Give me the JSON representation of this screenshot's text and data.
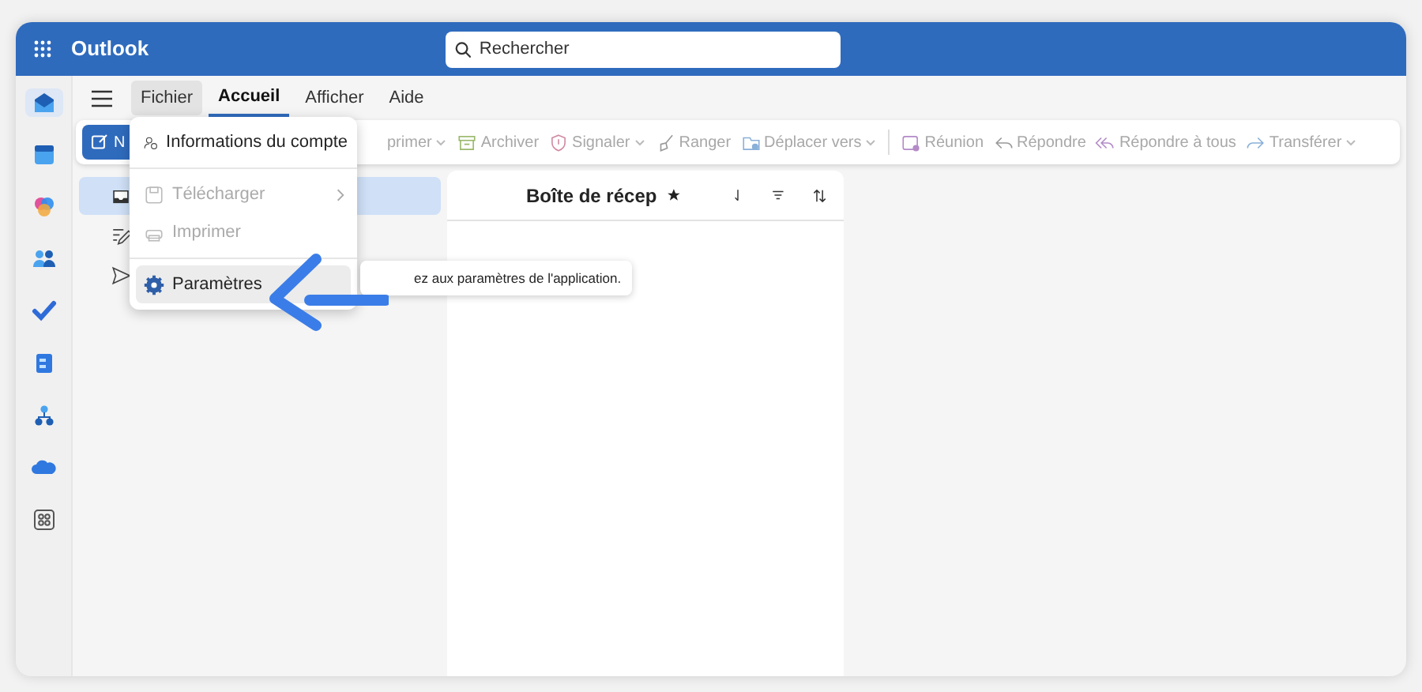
{
  "app": {
    "title": "Outlook",
    "search": {
      "placeholder": "Rechercher"
    }
  },
  "rail": [
    {
      "kind": "mail",
      "selected": true
    },
    {
      "kind": "calendar",
      "selected": false
    },
    {
      "kind": "copilot",
      "selected": false
    },
    {
      "kind": "people",
      "selected": false
    },
    {
      "kind": "todo",
      "selected": false
    },
    {
      "kind": "book",
      "selected": false
    },
    {
      "kind": "org",
      "selected": false
    },
    {
      "kind": "cloud",
      "selected": false
    },
    {
      "kind": "apps",
      "selected": false
    }
  ],
  "tabs": [
    {
      "label": "Fichier",
      "selected": false,
      "open": true
    },
    {
      "label": "Accueil",
      "selected": true,
      "open": false
    },
    {
      "label": "Afficher",
      "selected": false,
      "open": false
    },
    {
      "label": "Aide",
      "selected": false,
      "open": false
    }
  ],
  "toolbar": {
    "new_button": "N",
    "items": [
      {
        "kind": "delete",
        "label": "primer",
        "disabled": true,
        "dropdown": true
      },
      {
        "kind": "archive",
        "label": "Archiver",
        "disabled": true,
        "dropdown": false
      },
      {
        "kind": "report",
        "label": "Signaler",
        "disabled": true,
        "dropdown": true
      },
      {
        "kind": "sweep",
        "label": "Ranger",
        "disabled": true,
        "dropdown": false
      },
      {
        "kind": "move",
        "label": "Déplacer vers",
        "disabled": true,
        "dropdown": true
      },
      {
        "kind": "meeting",
        "label": "Réunion",
        "disabled": true,
        "dropdown": false
      },
      {
        "kind": "reply",
        "label": "Répondre",
        "disabled": true,
        "dropdown": false
      },
      {
        "kind": "replyall",
        "label": "Répondre à tous",
        "disabled": true,
        "dropdown": false
      },
      {
        "kind": "forward",
        "label": "Transférer",
        "disabled": true,
        "dropdown": true
      }
    ]
  },
  "folders": [
    {
      "kind": "inbox",
      "selected": true
    },
    {
      "kind": "drafts",
      "selected": false
    },
    {
      "kind": "sent",
      "selected": false
    }
  ],
  "message_list": {
    "title": "Boîte de récep"
  },
  "file_menu": [
    {
      "kind": "account",
      "label": "Informations du compte",
      "disabled": false,
      "selected": false,
      "submenu": false
    },
    {
      "kind": "download",
      "label": "Télécharger",
      "disabled": true,
      "selected": false,
      "submenu": true
    },
    {
      "kind": "print",
      "label": "Imprimer",
      "disabled": true,
      "selected": false,
      "submenu": false
    },
    {
      "kind": "settings",
      "label": "Paramètres",
      "disabled": false,
      "selected": true,
      "submenu": false
    }
  ],
  "tooltip": "ez aux paramètres de l'application."
}
